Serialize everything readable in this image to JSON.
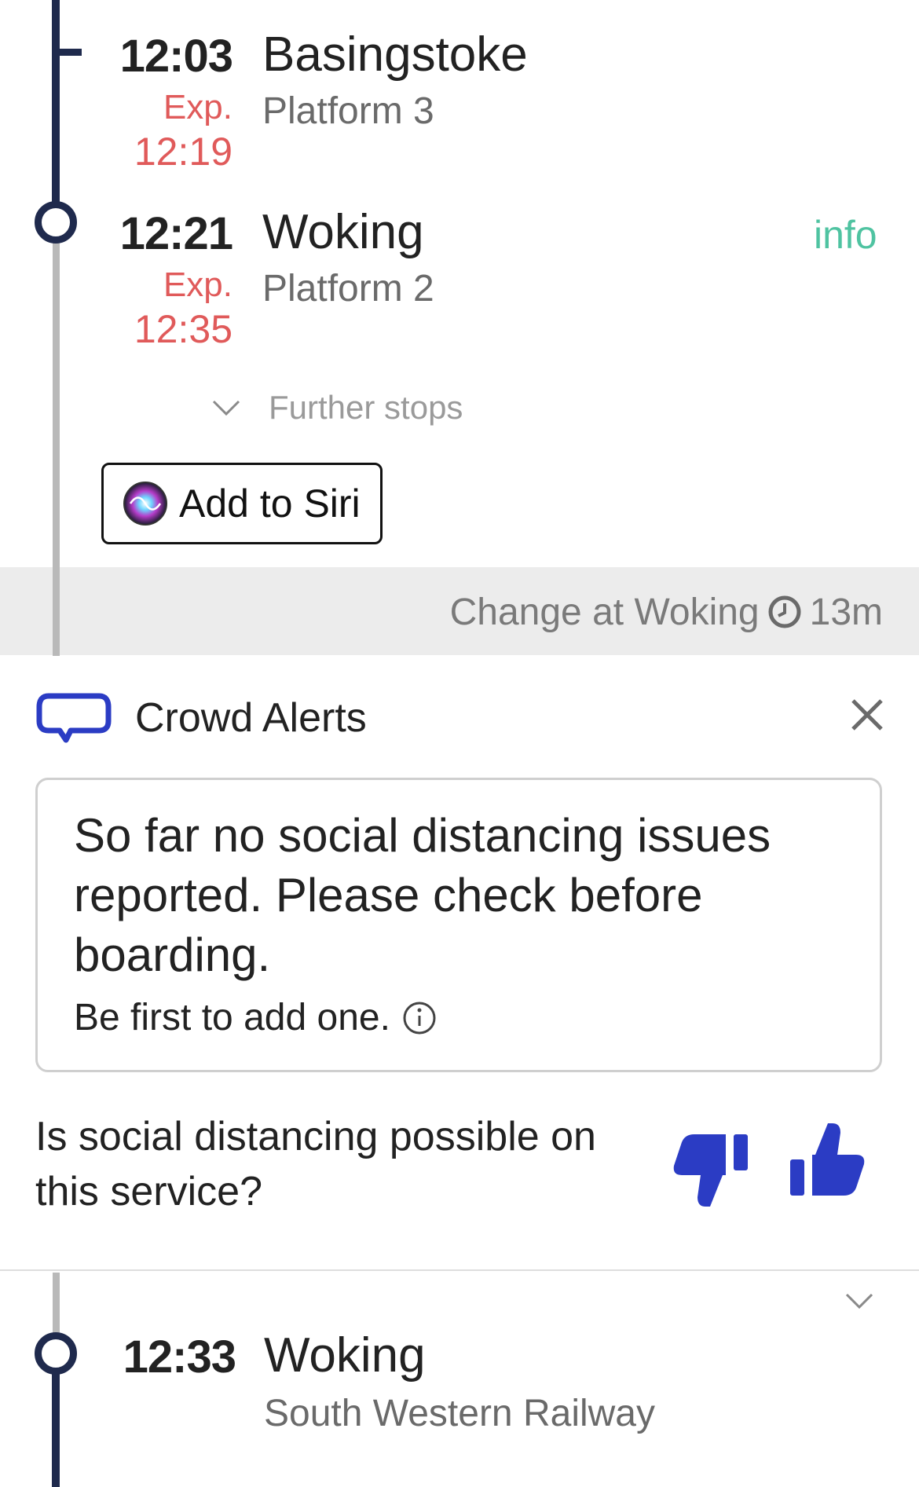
{
  "stops": [
    {
      "time": "12:03",
      "station": "Basingstoke",
      "exp_label": "Exp.",
      "exp_time": "12:19",
      "platform": "Platform 3"
    },
    {
      "time": "12:21",
      "station": "Woking",
      "exp_label": "Exp.",
      "exp_time": "12:35",
      "platform": "Platform 2",
      "info": "info"
    }
  ],
  "further_stops": "Further stops",
  "siri_label": "Add to Siri",
  "change": {
    "text": "Change at Woking",
    "duration": "13m"
  },
  "crowd": {
    "title": "Crowd Alerts",
    "message": "So far no social distancing issues reported. Please check before boarding.",
    "sub": "Be first to add one.",
    "question": "Is social distancing possible on this service?"
  },
  "next_leg": {
    "time": "12:33",
    "station": "Woking",
    "operator": "South Western Railway"
  },
  "colors": {
    "navy": "#1f2a4d",
    "accent_blue": "#2b3cc4",
    "alert_red": "#e05a5a",
    "info_green": "#4fc3a1"
  }
}
